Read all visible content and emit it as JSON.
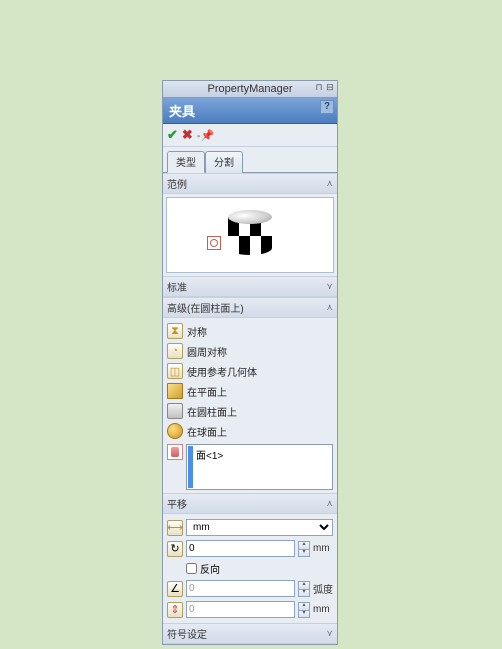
{
  "header": {
    "title": "PropertyManager"
  },
  "title": "夹具",
  "help": "?",
  "tabs": [
    {
      "label": "类型",
      "active": true
    },
    {
      "label": "分割",
      "active": false
    }
  ],
  "sections": {
    "example": {
      "title": "范例"
    },
    "standard": {
      "title": "标准"
    },
    "advanced": {
      "title": "高级(在圆柱面上)",
      "items": [
        {
          "id": "symmetry",
          "label": "对称"
        },
        {
          "id": "circular",
          "label": "圆周对称"
        },
        {
          "id": "refgeom",
          "label": "使用参考几何体"
        },
        {
          "id": "onplane",
          "label": "在平面上"
        },
        {
          "id": "oncyl",
          "label": "在圆柱面上"
        },
        {
          "id": "onsph",
          "label": "在球面上"
        }
      ],
      "selection": "面<1>"
    },
    "translation": {
      "title": "平移",
      "unit_selected": "mm",
      "unit_label1": "mm",
      "reverse_label": "反向",
      "reverse_checked": false,
      "radial_value": "0",
      "angular_value": "0",
      "angular_unit": "弧度",
      "axial_value": "0",
      "axial_unit": "mm"
    },
    "symbol": {
      "title": "符号设定"
    }
  }
}
